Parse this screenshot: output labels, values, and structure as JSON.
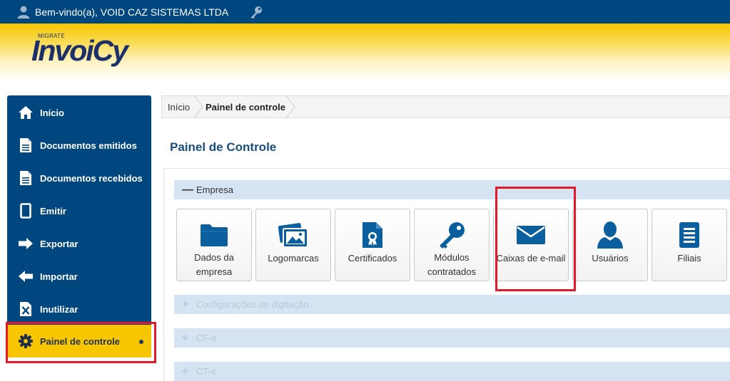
{
  "topbar": {
    "welcome": "Bem-vindo(a), VOID CAZ SISTEMAS LTDA",
    "user_icon": "user-icon",
    "key_icon": "key-icon"
  },
  "logo": {
    "small": "MIGRATE",
    "main": "InvoiCy"
  },
  "sidebar": {
    "items": [
      {
        "label": "Início",
        "icon": "home-icon"
      },
      {
        "label": "Documentos emitidos",
        "icon": "document-icon"
      },
      {
        "label": "Documentos recebidos",
        "icon": "document-icon"
      },
      {
        "label": "Emitir",
        "icon": "page-icon"
      },
      {
        "label": "Exportar",
        "icon": "arrow-right-icon"
      },
      {
        "label": "Importar",
        "icon": "arrow-left-icon"
      },
      {
        "label": "Inutilizar",
        "icon": "cancel-document-icon"
      },
      {
        "label": "Painel de controle",
        "icon": "gear-icon",
        "active": true
      }
    ]
  },
  "breadcrumb": {
    "items": [
      "Início",
      "Painel de controle"
    ]
  },
  "page": {
    "title": "Painel de Controle"
  },
  "sections": [
    {
      "title": "Empresa",
      "expanded": true,
      "sign": "—"
    },
    {
      "title": "Configurações de digitação",
      "expanded": false,
      "sign": "+"
    },
    {
      "title": "CF-e",
      "expanded": false,
      "sign": "+"
    },
    {
      "title": "CT-e",
      "expanded": false,
      "sign": "+"
    }
  ],
  "tiles": [
    {
      "label_line1": "Dados da",
      "label_line2": "empresa",
      "icon": "folder-icon"
    },
    {
      "label_line1": "Logomarcas",
      "label_line2": "",
      "icon": "image-icon"
    },
    {
      "label_line1": "Certificados",
      "label_line2": "",
      "icon": "certificate-icon"
    },
    {
      "label_line1": "Módulos",
      "label_line2": "contratados",
      "icon": "key-icon"
    },
    {
      "label_line1": "Caixas de e-mail",
      "label_line2": "",
      "icon": "envelope-icon"
    },
    {
      "label_line1": "Usuários",
      "label_line2": "",
      "icon": "user-icon"
    },
    {
      "label_line1": "Filiais",
      "label_line2": "",
      "icon": "list-document-icon"
    }
  ],
  "colors": {
    "topbar": "#00467f",
    "sidebar": "#00467f",
    "active_item": "#f7c600",
    "highlight": "#e3192a",
    "icon_blue": "#0b5f9e",
    "section_bar": "#d6e3f2"
  }
}
